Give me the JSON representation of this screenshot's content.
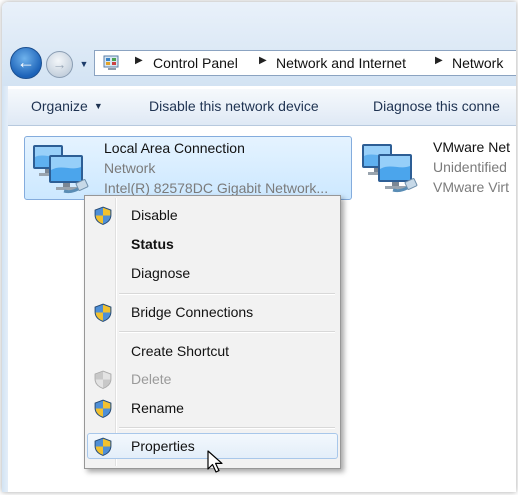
{
  "address": {
    "crumbs": [
      "Control Panel",
      "Network and Internet",
      "Network"
    ]
  },
  "toolbar": {
    "organize": "Organize",
    "disable_device": "Disable this network device",
    "diagnose": "Diagnose this conne"
  },
  "connections": [
    {
      "name": "Local Area Connection",
      "status": "Network",
      "adapter": "Intel(R) 82578DC Gigabit Network..."
    },
    {
      "name": "VMware Net",
      "status": "Unidentified",
      "adapter": "VMware Virt"
    }
  ],
  "context_menu": {
    "items": [
      {
        "label": "Disable",
        "icon": "uac-shield-icon"
      },
      {
        "label": "Status",
        "default": true
      },
      {
        "label": "Diagnose"
      },
      {
        "label": "Bridge Connections",
        "icon": "uac-shield-icon"
      },
      {
        "label": "Create Shortcut"
      },
      {
        "label": "Delete",
        "icon": "uac-shield-icon",
        "disabled": true
      },
      {
        "label": "Rename",
        "icon": "uac-shield-icon"
      },
      {
        "label": "Properties",
        "icon": "uac-shield-icon",
        "highlighted": true
      }
    ]
  }
}
